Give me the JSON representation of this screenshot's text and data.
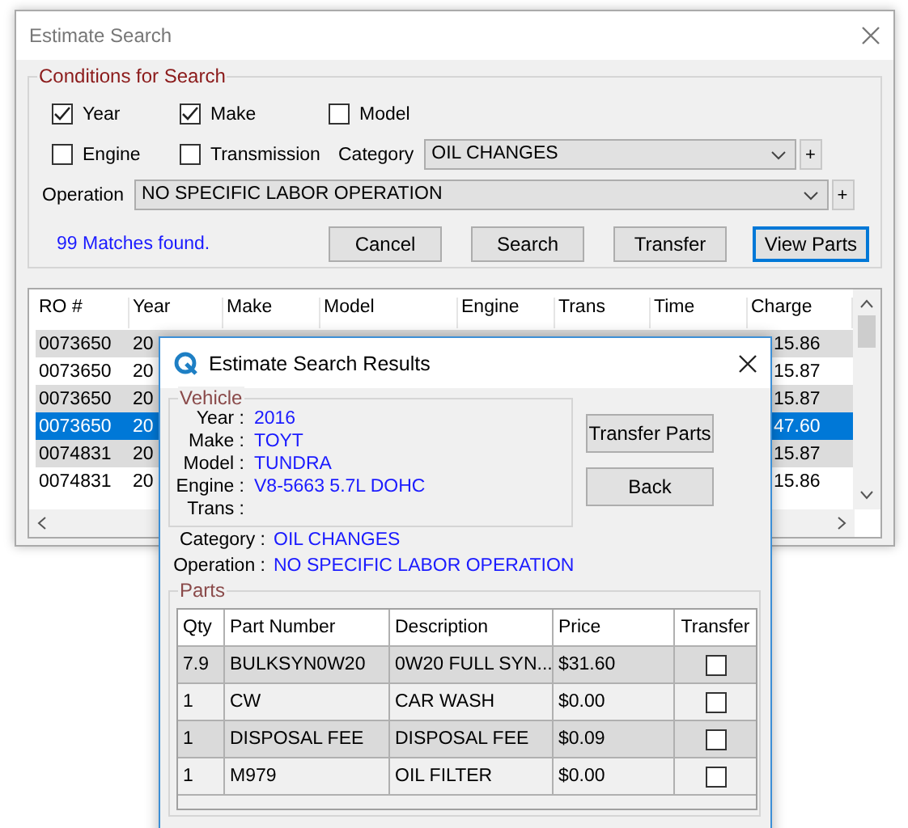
{
  "search_window": {
    "title": "Estimate Search"
  },
  "conditions": {
    "title": "Conditions for Search",
    "checkboxes": [
      {
        "label": "Year",
        "checked": true
      },
      {
        "label": "Make",
        "checked": true
      },
      {
        "label": "Model",
        "checked": false
      },
      {
        "label": "Engine",
        "checked": false
      },
      {
        "label": "Transmission",
        "checked": false
      }
    ],
    "category": {
      "label": "Category",
      "value": "OIL CHANGES",
      "add_button": "+"
    },
    "operation": {
      "label": "Operation",
      "value": "NO SPECIFIC LABOR OPERATION",
      "add_button": "+"
    }
  },
  "status": "99 Matches found.",
  "buttons": [
    {
      "label": "Cancel",
      "focused": false
    },
    {
      "label": "Search",
      "focused": false
    },
    {
      "label": "Transfer",
      "focused": false
    },
    {
      "label": "View Parts",
      "focused": true
    }
  ],
  "results_table": {
    "columns": [
      "RO #",
      "Year",
      "Make",
      "Model",
      "Engine",
      "Trans",
      "Time",
      "Charge"
    ],
    "rows": [
      {
        "ro": "0073650",
        "year": "20",
        "charge": "15.86",
        "selected": false
      },
      {
        "ro": "0073650",
        "year": "20",
        "charge": "15.87",
        "selected": false
      },
      {
        "ro": "0073650",
        "year": "20",
        "charge": "15.87",
        "selected": false
      },
      {
        "ro": "0073650",
        "year": "20",
        "charge": "47.60",
        "selected": true
      },
      {
        "ro": "0074831",
        "year": "20",
        "charge": "15.87",
        "selected": false
      },
      {
        "ro": "0074831",
        "year": "20",
        "charge": "15.86",
        "selected": false
      }
    ]
  },
  "results_dialog": {
    "title": "Estimate Search Results",
    "vehicle": {
      "title": "Vehicle",
      "fields": [
        {
          "label": "Year :",
          "value": "2016"
        },
        {
          "label": "Make :",
          "value": "TOYT"
        },
        {
          "label": "Model :",
          "value": "TUNDRA"
        },
        {
          "label": "Engine :",
          "value": "V8-5663 5.7L DOHC"
        },
        {
          "label": "Trans :"
        }
      ]
    },
    "buttons": [
      "Transfer Parts",
      "Back"
    ],
    "category": {
      "label": "Category :",
      "value": "OIL CHANGES"
    },
    "operation": {
      "label": "Operation :",
      "value": "NO SPECIFIC LABOR OPERATION"
    },
    "parts": {
      "title": "Parts",
      "columns": [
        "Qty",
        "Part Number",
        "Description",
        "Price",
        "Transfer"
      ],
      "rows": [
        {
          "qty": "7.9",
          "part_number": "BULKSYN0W20",
          "description": "0W20 FULL SYN...",
          "price": "$31.60",
          "transfer": false
        },
        {
          "qty": "1",
          "part_number": "CW",
          "description": "CAR WASH",
          "price": "$0.00",
          "transfer": false
        },
        {
          "qty": "1",
          "part_number": "DISPOSAL FEE",
          "description": "DISPOSAL FEE",
          "price": "$0.09",
          "transfer": false
        },
        {
          "qty": "1",
          "part_number": "M979",
          "description": "OIL FILTER",
          "price": "$0.00",
          "transfer": false
        }
      ]
    }
  }
}
